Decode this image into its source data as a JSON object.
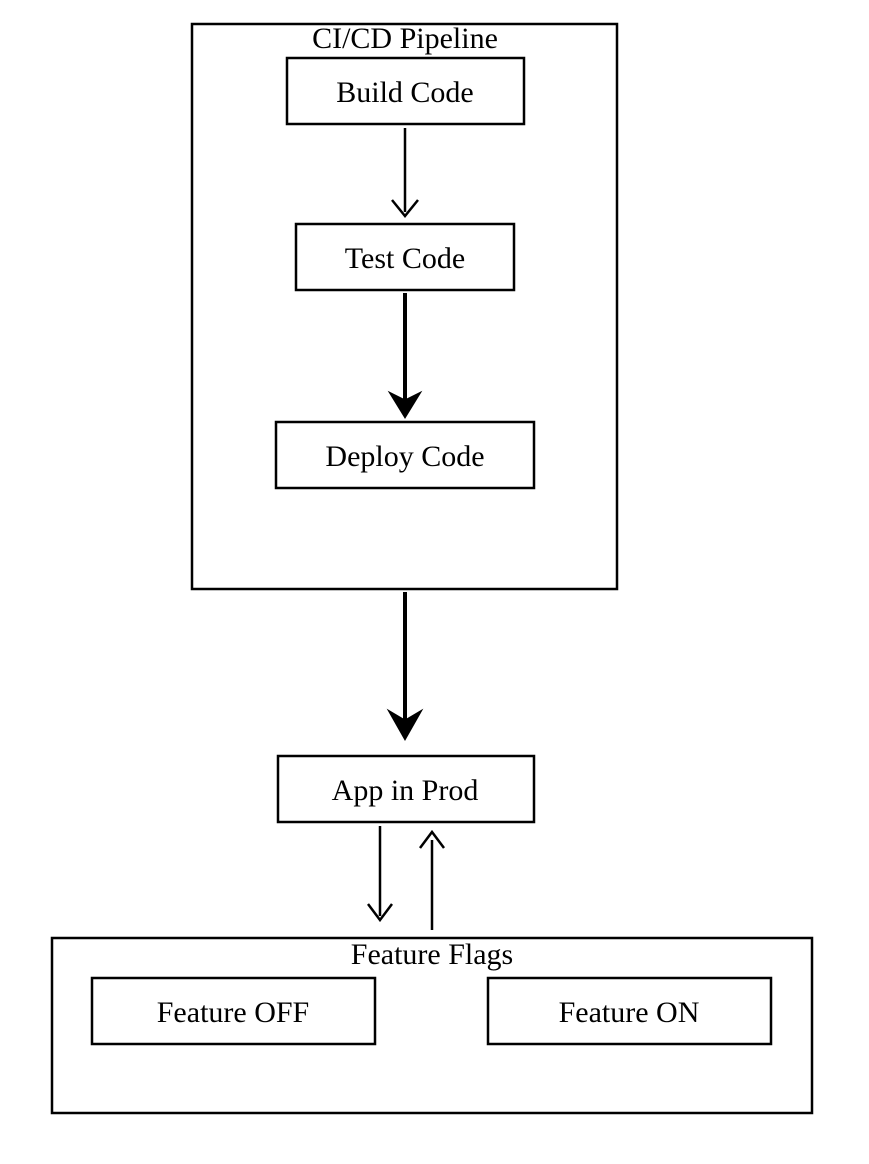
{
  "pipeline": {
    "title": "CI/CD Pipeline",
    "stages": {
      "build": "Build Code",
      "test": "Test Code",
      "deploy": "Deploy Code"
    }
  },
  "app": {
    "label": "App in Prod"
  },
  "flags": {
    "title": "Feature Flags",
    "off": "Feature OFF",
    "on": "Feature ON"
  }
}
